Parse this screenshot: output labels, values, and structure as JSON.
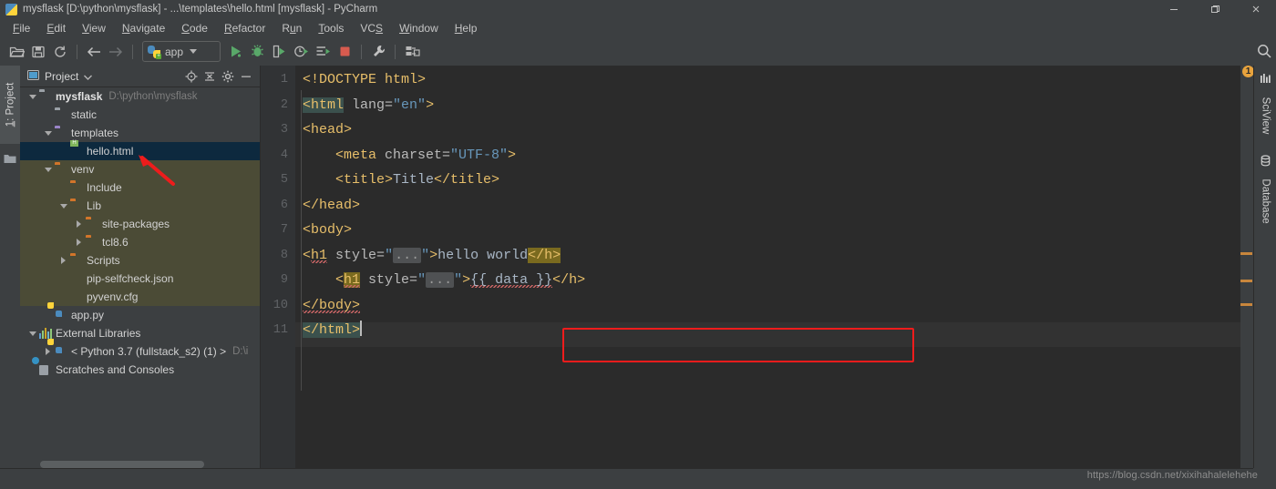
{
  "window": {
    "title": "mysflask [D:\\python\\mysflask] - ...\\templates\\hello.html [mysflask] - PyCharm",
    "app_icon": "pycharm-icon",
    "controls": [
      {
        "name": "minimize-button",
        "glyph": "minimize-icon"
      },
      {
        "name": "restore-button",
        "glyph": "restore-icon"
      },
      {
        "name": "close-button",
        "glyph": "close-icon"
      }
    ]
  },
  "menubar": {
    "items": [
      {
        "label": "File",
        "mnemonic": "F"
      },
      {
        "label": "Edit",
        "mnemonic": "E"
      },
      {
        "label": "View",
        "mnemonic": "V"
      },
      {
        "label": "Navigate",
        "mnemonic": "N"
      },
      {
        "label": "Code",
        "mnemonic": "C"
      },
      {
        "label": "Refactor",
        "mnemonic": "R"
      },
      {
        "label": "Run",
        "mnemonic": "u"
      },
      {
        "label": "Tools",
        "mnemonic": "T"
      },
      {
        "label": "VCS",
        "mnemonic": "S"
      },
      {
        "label": "Window",
        "mnemonic": "W"
      },
      {
        "label": "Help",
        "mnemonic": "H"
      }
    ]
  },
  "toolbar": {
    "icons_left": [
      "open-folder-icon",
      "save-all-icon",
      "sync-refresh-icon"
    ],
    "nav_icons": [
      "back-arrow-icon",
      "forward-arrow-icon"
    ],
    "run_config": {
      "label": "app",
      "icon": "python-run-config-icon",
      "chevron": "chevron-down-icon"
    },
    "icons_run": [
      "run-icon",
      "debug-icon",
      "run-with-coverage-icon",
      "profile-icon",
      "run-dashboard-icon",
      "stop-icon"
    ],
    "icons_right": [
      "settings-wrench-icon",
      "deploy-icon"
    ],
    "search": {
      "icon": "search-icon"
    }
  },
  "left_stripe": {
    "tab_label": "1: Project",
    "tab_mnemonic": "1",
    "folder_icon": "folder-icon"
  },
  "project_panel": {
    "title": "Project",
    "title_icon": "project-window-icon",
    "title_chevron": "chevron-down-icon",
    "header_buttons": [
      "locate-target-icon",
      "collapse-all-icon",
      "gear-icon",
      "minimize-panel-icon"
    ],
    "tree": [
      {
        "label": "mysflask",
        "path": "D:\\python\\mysflask",
        "depth": 0,
        "icon": "folder-grey",
        "state": "expanded",
        "bold": true,
        "selected": false,
        "tint": "none"
      },
      {
        "label": "static",
        "path": "",
        "depth": 1,
        "icon": "folder-grey",
        "state": "leaf",
        "bold": false,
        "selected": false,
        "tint": "none"
      },
      {
        "label": "templates",
        "path": "",
        "depth": 1,
        "icon": "folder-purple",
        "state": "expanded",
        "bold": false,
        "selected": false,
        "tint": "none"
      },
      {
        "label": "hello.html",
        "path": "",
        "depth": 2,
        "icon": "html-file",
        "state": "leaf",
        "bold": false,
        "selected": true,
        "tint": "none"
      },
      {
        "label": "venv",
        "path": "",
        "depth": 1,
        "icon": "folder-orange",
        "state": "expanded",
        "bold": false,
        "selected": false,
        "tint": "venv"
      },
      {
        "label": "Include",
        "path": "",
        "depth": 2,
        "icon": "folder-orange",
        "state": "leaf",
        "bold": false,
        "selected": false,
        "tint": "venv"
      },
      {
        "label": "Lib",
        "path": "",
        "depth": 2,
        "icon": "folder-orange",
        "state": "expanded",
        "bold": false,
        "selected": false,
        "tint": "venv"
      },
      {
        "label": "site-packages",
        "path": "",
        "depth": 3,
        "icon": "folder-orange",
        "state": "collapsed",
        "bold": false,
        "selected": false,
        "tint": "venv"
      },
      {
        "label": "tcl8.6",
        "path": "",
        "depth": 3,
        "icon": "folder-orange",
        "state": "collapsed",
        "bold": false,
        "selected": false,
        "tint": "venv"
      },
      {
        "label": "Scripts",
        "path": "",
        "depth": 2,
        "icon": "folder-orange",
        "state": "collapsed",
        "bold": false,
        "selected": false,
        "tint": "venv"
      },
      {
        "label": "pip-selfcheck.json",
        "path": "",
        "depth": 2,
        "icon": "json-file",
        "state": "leaf",
        "bold": false,
        "selected": false,
        "tint": "venv"
      },
      {
        "label": "pyvenv.cfg",
        "path": "",
        "depth": 2,
        "icon": "cfg-file",
        "state": "leaf",
        "bold": false,
        "selected": false,
        "tint": "venv"
      },
      {
        "label": "app.py",
        "path": "",
        "depth": 1,
        "icon": "python-file",
        "state": "leaf",
        "bold": false,
        "selected": false,
        "tint": "none"
      },
      {
        "label": "External Libraries",
        "path": "",
        "depth": 0,
        "icon": "libraries-icon",
        "state": "expanded",
        "bold": false,
        "selected": false,
        "tint": "none"
      },
      {
        "label": "< Python 3.7 (fullstack_s2) (1) >",
        "path": "D:\\i",
        "depth": 1,
        "icon": "python-sdk",
        "state": "collapsed",
        "bold": false,
        "selected": false,
        "tint": "none"
      },
      {
        "label": "Scratches and Consoles",
        "path": "",
        "depth": 0,
        "icon": "scratches-icon",
        "state": "leaf",
        "bold": false,
        "selected": false,
        "tint": "none"
      }
    ]
  },
  "editor": {
    "file": "hello.html",
    "line_numbers": [
      1,
      2,
      3,
      4,
      5,
      6,
      7,
      8,
      9,
      10,
      11
    ],
    "current_line": 11,
    "lines": [
      {
        "n": 1,
        "segments": [
          {
            "t": "<!DOCTYPE html>",
            "c": "tag"
          }
        ]
      },
      {
        "n": 2,
        "segments": [
          {
            "t": "<html",
            "c": "tag hl-teal"
          },
          {
            "t": " ",
            "c": "attr"
          },
          {
            "t": "lang=",
            "c": "attr"
          },
          {
            "t": "\"en\"",
            "c": "val"
          },
          {
            "t": ">",
            "c": "tag"
          }
        ]
      },
      {
        "n": 3,
        "segments": [
          {
            "t": "<head>",
            "c": "tag"
          }
        ]
      },
      {
        "n": 4,
        "segments": [
          {
            "t": "    <meta ",
            "c": "tag"
          },
          {
            "t": "charset=",
            "c": "attr"
          },
          {
            "t": "\"UTF-8\"",
            "c": "val"
          },
          {
            "t": ">",
            "c": "tag"
          }
        ]
      },
      {
        "n": 5,
        "segments": [
          {
            "t": "    <title>",
            "c": "tag"
          },
          {
            "t": "Title",
            "c": "txt"
          },
          {
            "t": "</title>",
            "c": "tag"
          }
        ]
      },
      {
        "n": 6,
        "segments": [
          {
            "t": "</head>",
            "c": "tag"
          }
        ]
      },
      {
        "n": 7,
        "segments": [
          {
            "t": "<body>",
            "c": "tag"
          }
        ]
      },
      {
        "n": 8,
        "segments": [
          {
            "t": "<",
            "c": "tag"
          },
          {
            "t": "h1",
            "c": "tag sq"
          },
          {
            "t": " ",
            "c": "attr"
          },
          {
            "t": "style=",
            "c": "attr"
          },
          {
            "t": "\"",
            "c": "val"
          },
          {
            "t": "...",
            "c": "fold"
          },
          {
            "t": "\"",
            "c": "val"
          },
          {
            "t": ">",
            "c": "tag"
          },
          {
            "t": "hello world",
            "c": "txt"
          },
          {
            "t": "</h>",
            "c": "tag hl-olive"
          }
        ]
      },
      {
        "n": 9,
        "segments": [
          {
            "t": "    <",
            "c": "tag"
          },
          {
            "t": "h1",
            "c": "tag hl-olive sq"
          },
          {
            "t": " ",
            "c": "attr"
          },
          {
            "t": "style=",
            "c": "attr"
          },
          {
            "t": "\"",
            "c": "val"
          },
          {
            "t": "...",
            "c": "fold"
          },
          {
            "t": "\"",
            "c": "val"
          },
          {
            "t": ">",
            "c": "tag"
          },
          {
            "t": "{{ data }}",
            "c": "txt sq"
          },
          {
            "t": "</h>",
            "c": "tag"
          }
        ]
      },
      {
        "n": 10,
        "segments": [
          {
            "t": "</body>",
            "c": "tag sq"
          }
        ]
      },
      {
        "n": 11,
        "segments": [
          {
            "t": "</html>",
            "c": "tag hl-teal"
          },
          {
            "t": "|",
            "c": "caret"
          }
        ]
      }
    ],
    "raw_text": "<!DOCTYPE html>\n<html lang=\"en\">\n<head>\n    <meta charset=\"UTF-8\">\n    <title>Title</title>\n</head>\n<body>\n<h1 style=\"...\">hello world</h>\n    <h1 style=\"...\">{{ data }}</h>\n</body>\n</html>"
  },
  "annotations": {
    "red_box_target": "line-9-h1-tag",
    "red_arrow_target": "hello.html"
  },
  "inspection": {
    "warning_count": "1",
    "badge_color": "#e8a33d",
    "marker_color": "#c8863c",
    "markers": 3
  },
  "right_stripe": {
    "tabs": [
      {
        "label": "SciView",
        "icon": "sciview-icon"
      },
      {
        "label": "Database",
        "icon": "database-icon"
      }
    ]
  },
  "status_bar": {
    "watermark": "https://blog.csdn.net/xixihahalelehehe"
  }
}
